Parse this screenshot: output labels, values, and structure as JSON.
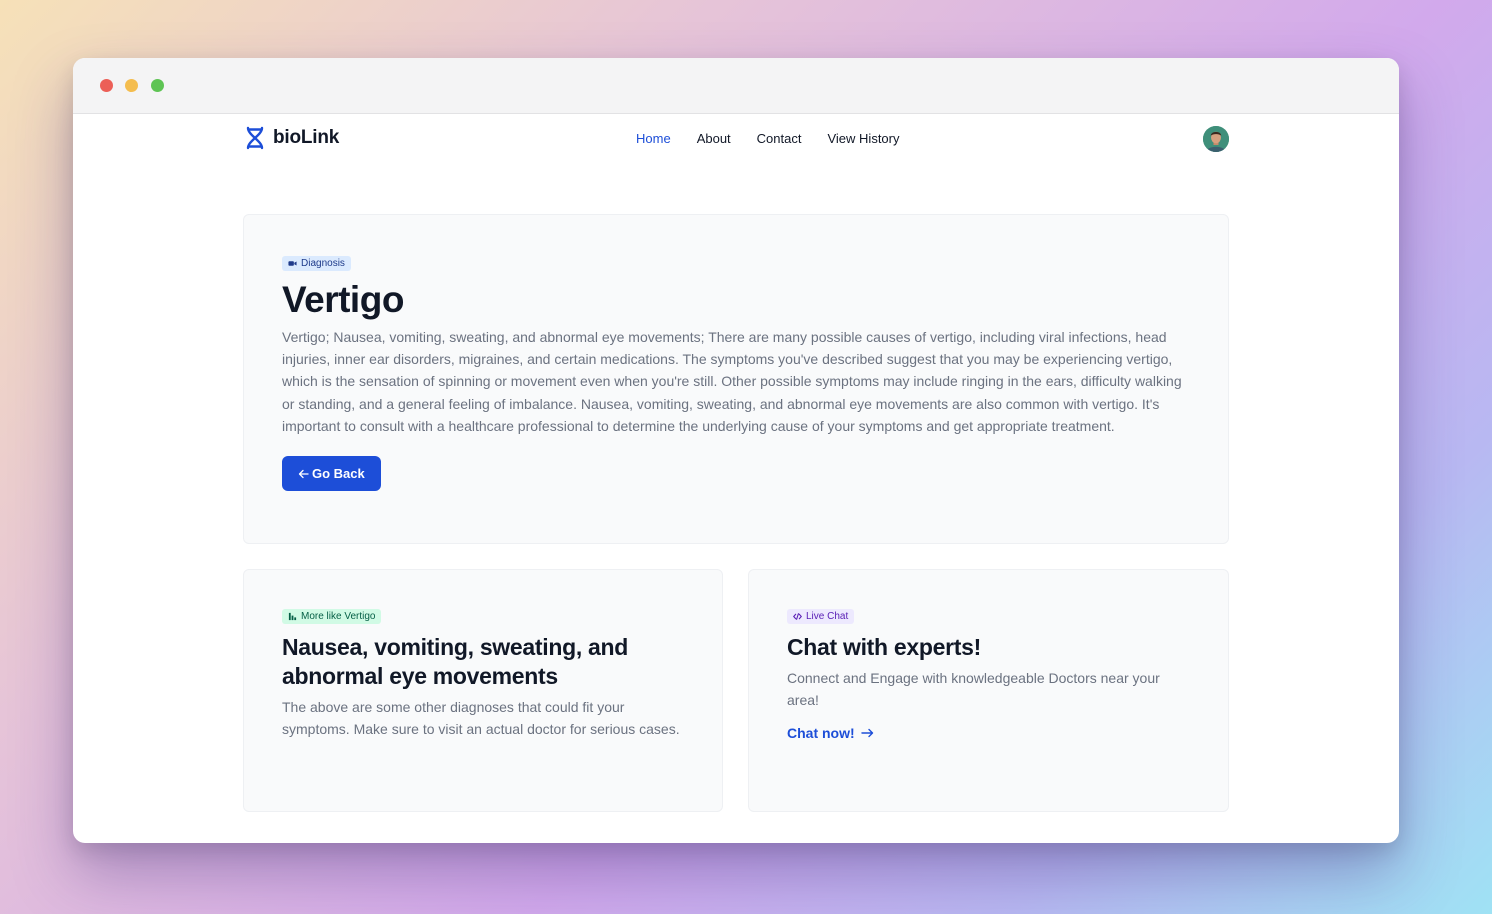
{
  "brand": {
    "name": "bioLink",
    "icon": "dna-icon",
    "color": "#1d4ed8"
  },
  "nav": {
    "items": [
      {
        "label": "Home",
        "active": true
      },
      {
        "label": "About",
        "active": false
      },
      {
        "label": "Contact",
        "active": false
      },
      {
        "label": "View History",
        "active": false
      }
    ]
  },
  "user": {
    "avatar": "user-avatar"
  },
  "diagnosis": {
    "badge": "Diagnosis",
    "badge_icon": "video-icon",
    "title": "Vertigo",
    "description": "Vertigo; Nausea, vomiting, sweating, and abnormal eye movements; There are many possible causes of vertigo, including viral infections, head injuries, inner ear disorders, migraines, and certain medications. The symptoms you've described suggest that you may be experiencing vertigo, which is the sensation of spinning or movement even when you're still. Other possible symptoms may include ringing in the ears, difficulty walking or standing, and a general feeling of imbalance. Nausea, vomiting, sweating, and abnormal eye movements are also common with vertigo. It's important to consult with a healthcare professional to determine the underlying cause of your symptoms and get appropriate treatment.",
    "back_button": "Go Back",
    "back_icon": "arrow-left-icon"
  },
  "related": {
    "badge": "More like Vertigo",
    "badge_icon": "chart-icon",
    "title": "Nausea, vomiting, sweating, and abnormal eye movements",
    "description": "The above are some other diagnoses that could fit your symptoms. Make sure to visit an actual doctor for serious cases."
  },
  "chat": {
    "badge": "Live Chat",
    "badge_icon": "code-icon",
    "title": "Chat with experts!",
    "description": "Connect and Engage with knowledgeable Doctors near your area!",
    "link": "Chat now!",
    "link_icon": "arrow-right-icon"
  },
  "colors": {
    "accent": "#1d4ed8",
    "heading": "#111827",
    "body_text": "#6b7280",
    "card_bg": "#f9fafb"
  }
}
